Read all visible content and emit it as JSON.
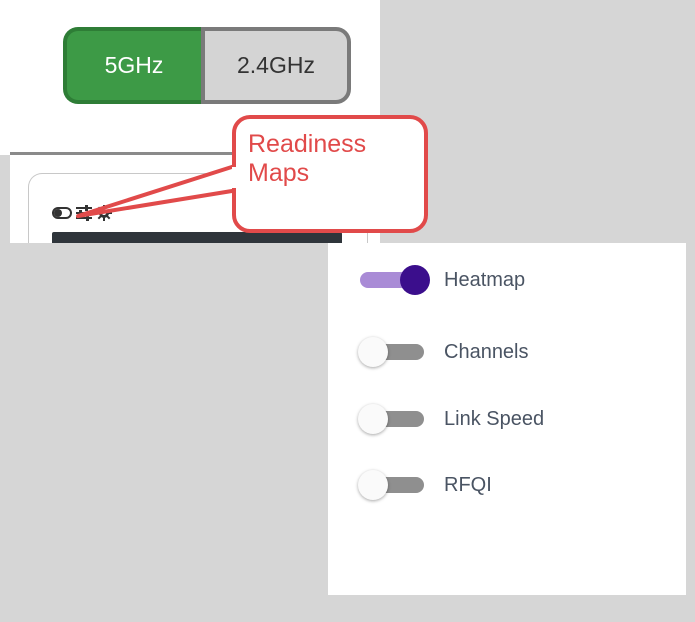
{
  "band_selector": {
    "options": [
      {
        "label": "5GHz",
        "selected": true
      },
      {
        "label": "2.4GHz",
        "selected": false
      }
    ]
  },
  "card_toolbar": {
    "icons": [
      "toggle-icon",
      "sliders-icon",
      "gear-icon"
    ]
  },
  "callout": {
    "text_line1": "Readiness",
    "text_line2": "Maps"
  },
  "map_layers": {
    "items": [
      {
        "label": "Heatmap",
        "enabled": true
      },
      {
        "label": "Channels",
        "enabled": false
      },
      {
        "label": "Link Speed",
        "enabled": false
      },
      {
        "label": "RFQI",
        "enabled": false
      }
    ]
  },
  "colors": {
    "selected_band": "#3d9a46",
    "callout": "#e14a4a",
    "toggle_on": "#3b0e8c",
    "toggle_off": "#8f8f8f"
  }
}
